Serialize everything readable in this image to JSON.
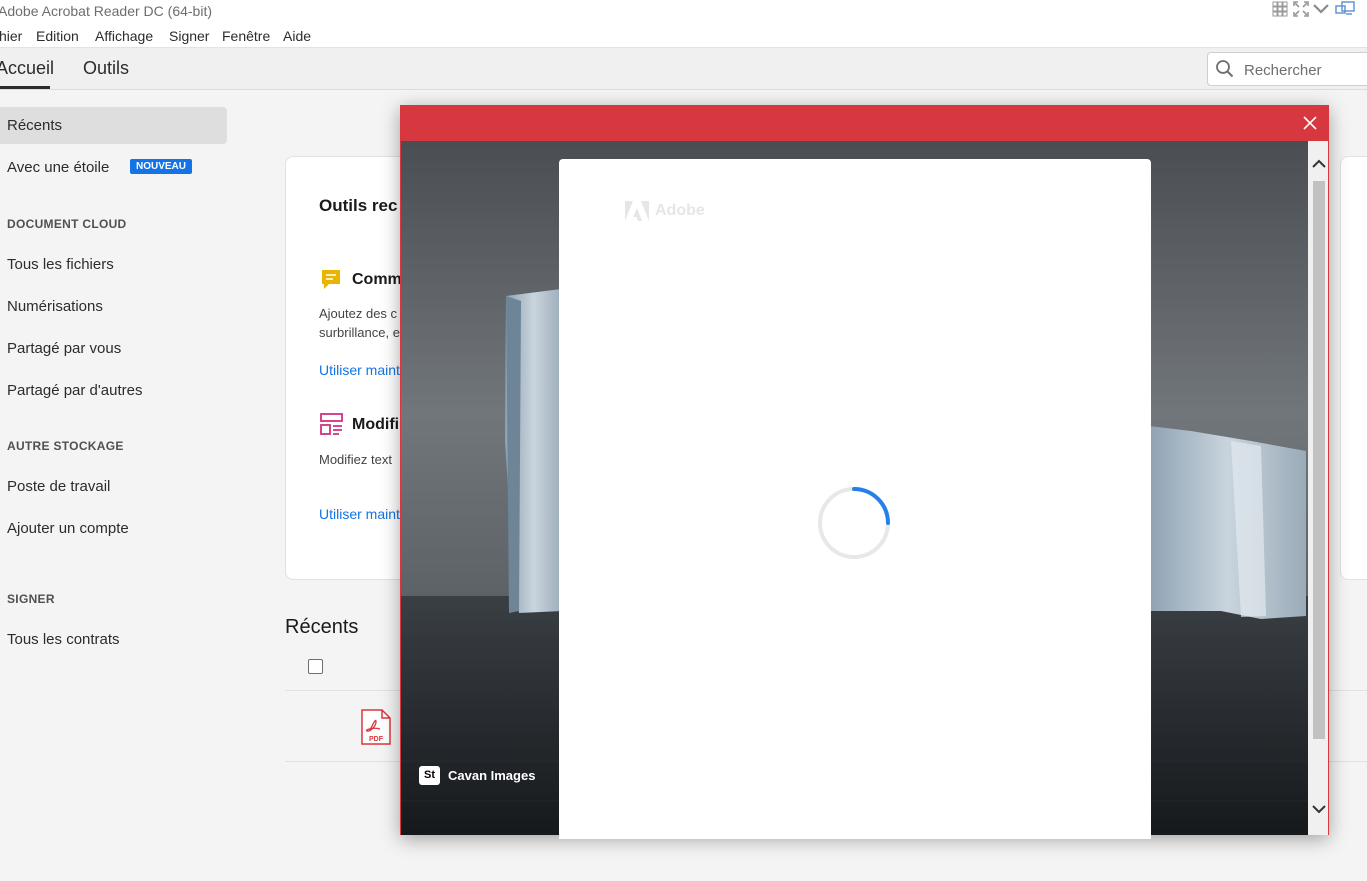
{
  "window": {
    "title": "Adobe Acrobat Reader DC (64-bit)"
  },
  "menu": [
    "hier",
    "Edition",
    "Affichage",
    "Signer",
    "Fenêtre",
    "Aide"
  ],
  "tabs": {
    "home": "Accueil",
    "tools": "Outils"
  },
  "search": {
    "placeholder": "Rechercher"
  },
  "sidebar": {
    "recents": "Récents",
    "starred": "Avec une étoile",
    "starred_badge": "NOUVEAU",
    "section_cloud": "DOCUMENT CLOUD",
    "all_files": "Tous les fichiers",
    "scans": "Numérisations",
    "shared_by_you": "Partagé par vous",
    "shared_by_others": "Partagé par d'autres",
    "section_other": "AUTRE STOCKAGE",
    "workstation": "Poste de travail",
    "add_account": "Ajouter un compte",
    "section_sign": "SIGNER",
    "all_contracts": "Tous les contrats"
  },
  "tools_card": {
    "heading": "Outils rec",
    "tool1_title": "Comm",
    "tool1_desc_line1": "Ajoutez des c",
    "tool1_desc_line2": "surbrillance, e",
    "tool1_link": "Utiliser maint",
    "tool2_title": "Modifi",
    "tool2_desc": "Modifiez text",
    "tool2_link": "Utiliser maint"
  },
  "recents_section": {
    "heading": "Récents",
    "file_icon_label": "PDF"
  },
  "overlay": {
    "adobe_logo_text": "Adobe",
    "credit_badge": "St",
    "credit_text": "Cavan Images"
  },
  "colors": {
    "accent_red": "#d7373f",
    "link_blue": "#1473e6",
    "badge_blue": "#1473e6",
    "spinner_blue": "#2680eb"
  },
  "icons": [
    "grid-icon",
    "expand-icon",
    "chevron-down-icon",
    "screen-icon",
    "search-icon",
    "comment-icon",
    "edit-pdf-icon",
    "pdf-file-icon",
    "close-icon",
    "adobe-logo-icon",
    "loading-spinner",
    "scroll-up-icon",
    "scroll-down-icon"
  ]
}
